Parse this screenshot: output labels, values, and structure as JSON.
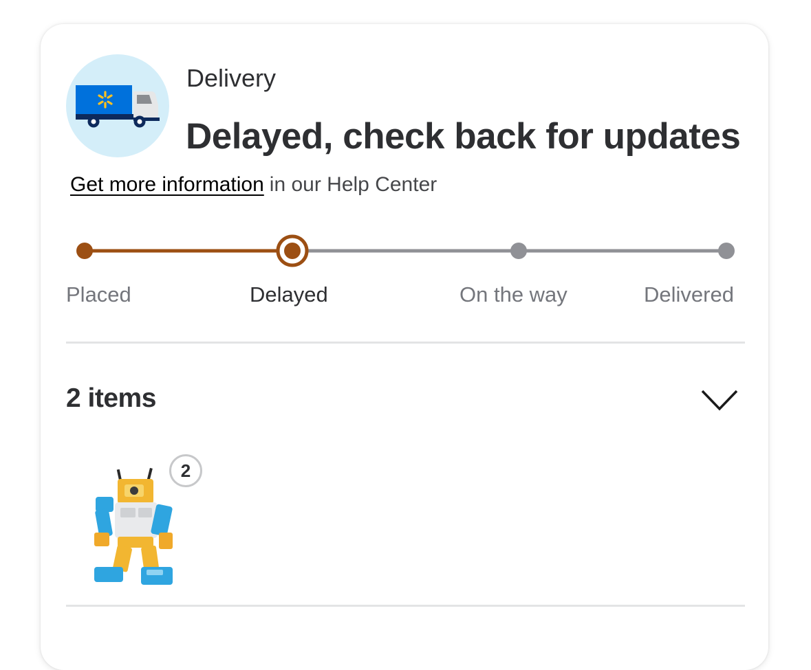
{
  "delivery": {
    "type_label": "Delivery",
    "status_headline": "Delayed, check back for updates",
    "help_link_text": "Get more information",
    "help_suffix": "in our Help Center"
  },
  "tracker": {
    "steps": [
      {
        "label": "Placed",
        "state": "done"
      },
      {
        "label": "Delayed",
        "state": "current"
      },
      {
        "label": "On the way",
        "state": "pending"
      },
      {
        "label": "Delivered",
        "state": "pending"
      }
    ],
    "colors": {
      "active": "#9c4f13",
      "inactive": "#909196"
    }
  },
  "items": {
    "count_label": "2 items",
    "list": [
      {
        "icon": "robot-toy-image",
        "quantity": "2"
      }
    ]
  },
  "icons": {
    "truck": "delivery-truck-icon",
    "expand": "chevron-down-icon"
  }
}
